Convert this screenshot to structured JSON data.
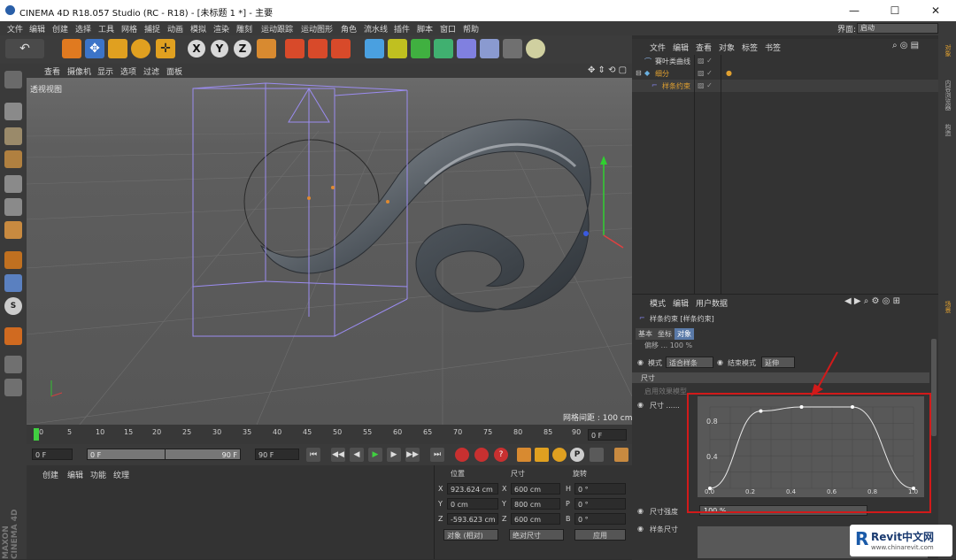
{
  "titlebar": {
    "title": "CINEMA 4D R18.057 Studio (RC - R18) - [未标题 1 *] - 主要",
    "minimize": "—",
    "maximize": "☐",
    "close": "✕"
  },
  "menubar": {
    "items": [
      "文件",
      "编辑",
      "创建",
      "选择",
      "工具",
      "网格",
      "捕捉",
      "动画",
      "模拟",
      "渲染",
      "雕刻",
      "运动跟踪",
      "运动图形",
      "角色",
      "流水线",
      "插件",
      "脚本",
      "窗口",
      "帮助"
    ],
    "layout_label": "界面:",
    "layout_value": "启动"
  },
  "axis_buttons": [
    "X",
    "Y",
    "Z"
  ],
  "viewport": {
    "menu": [
      "查看",
      "摄像机",
      "显示",
      "选项",
      "过滤",
      "面板"
    ],
    "label": "透视视图",
    "grid_spacing": "网格间距 : 100 cm"
  },
  "timeline": {
    "ticks": [
      "0",
      "5",
      "10",
      "15",
      "20",
      "25",
      "30",
      "35",
      "40",
      "45",
      "50",
      "55",
      "60",
      "65",
      "70",
      "75",
      "80",
      "85",
      "90"
    ],
    "end_frame": "0 F"
  },
  "transport": {
    "start": "0 F",
    "mid_left": "0 F",
    "mid_right": "90 F",
    "end": "90 F"
  },
  "material_menu": [
    "创建",
    "编辑",
    "功能",
    "纹理"
  ],
  "coords": {
    "headers": [
      "位置",
      "尺寸",
      "旋转"
    ],
    "rows": [
      {
        "a": "X",
        "pos": "923.624 cm",
        "b": "X",
        "size": "600 cm",
        "c": "H",
        "rot": "0 °"
      },
      {
        "a": "Y",
        "pos": "0 cm",
        "b": "Y",
        "size": "800 cm",
        "c": "P",
        "rot": "0 °"
      },
      {
        "a": "Z",
        "pos": "-593.623 cm",
        "b": "Z",
        "size": "600 cm",
        "c": "B",
        "rot": "0 °"
      }
    ],
    "mode": "对象 (相对)",
    "size_mode": "绝对尺寸",
    "apply": "应用"
  },
  "objmgr": {
    "menu": [
      "文件",
      "编辑",
      "查看",
      "对象",
      "标签",
      "书签"
    ],
    "objects": [
      {
        "name": "賽叶类曲线",
        "highlight": false
      },
      {
        "name": "细分",
        "highlight": true
      },
      {
        "name": "样条约束",
        "highlight": true
      }
    ]
  },
  "right_tabs": [
    "对象",
    "内容浏览器",
    "构造",
    "场景"
  ],
  "attr": {
    "menu": [
      "模式",
      "编辑",
      "用户数据"
    ],
    "title": "样条约束 [样条约束]",
    "tabs": [
      "基本",
      "坐标",
      "对象"
    ],
    "partial_row": "偏移 ... 100 %",
    "mode_label": "模式",
    "mode_value": "适合样条",
    "end_mode_label": "结束模式",
    "end_mode_value": "延伸",
    "section": "尺寸",
    "use_spline": "启用效果模型",
    "size_label": "尺寸 ......",
    "strength_label": "尺寸强度",
    "strength_value": "100 %",
    "spline_size_label": "样条尺寸",
    "curve_y_ticks": [
      "0.8",
      "0.4"
    ],
    "curve_x_ticks": [
      "0.0",
      "0.2",
      "0.4",
      "0.6",
      "0.8",
      "1.0"
    ]
  },
  "curve_data": {
    "x": [
      0.0,
      0.25,
      0.45,
      0.7,
      1.0
    ],
    "y": [
      0.0,
      0.95,
      1.0,
      1.0,
      0.0
    ]
  },
  "logo": {
    "brand": "Revit中文网",
    "url": "www.chinarevit.com"
  },
  "maxon": "MAXON CINEMA 4D",
  "colors": {
    "accent": "#e0a030",
    "redbox": "#d21a1a",
    "bbox": "#9b8cf0"
  }
}
